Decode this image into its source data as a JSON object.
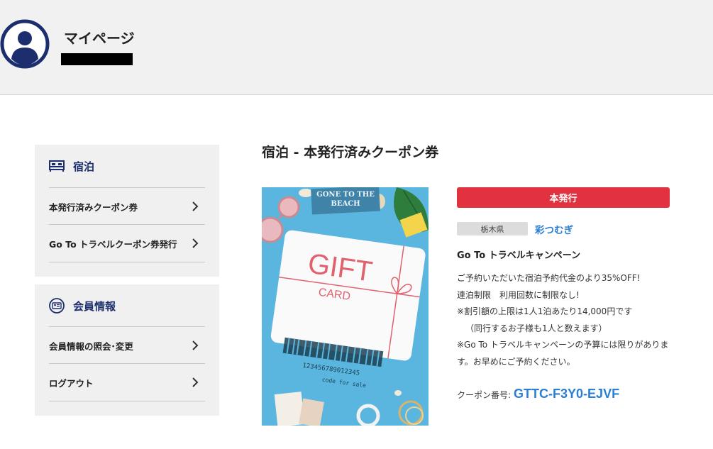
{
  "header": {
    "title": "マイページ",
    "avatar_icon": "user-avatar-icon",
    "accent": "#1c2e6e"
  },
  "sidebar": {
    "sections": [
      {
        "title": "宿泊",
        "icon": "bed-icon",
        "items": [
          {
            "label": "本発行済みクーポン券"
          },
          {
            "label": "Go To トラベルクーポン券発行"
          }
        ]
      },
      {
        "title": "会員情報",
        "icon": "member-card-icon",
        "items": [
          {
            "label": "会員情報の照会･変更"
          },
          {
            "label": "ログアウト"
          }
        ]
      }
    ]
  },
  "main": {
    "title": "宿泊 - 本発行済みクーポン券",
    "image_text": {
      "sign": "GONE TO THE",
      "sign2": "BEACH",
      "gift": "GIFT",
      "card": "CARD",
      "barcode_number": "123456789012345",
      "code_for_sale": "code for sale"
    },
    "status": {
      "label": "本発行",
      "color": "#e2323f"
    },
    "prefecture": "栃木県",
    "hotel_name": "彩つむぎ",
    "campaign": "Go To トラベルキャンペーン",
    "description": [
      "ご予約いただいた宿泊予約代金のより35%OFF!",
      "連泊制限　利用回数に制限なし!",
      "※割引額の上限は1人1泊あたり14,000円です",
      "（同行するお子様も1人と数えます）",
      "※Go To トラベルキャンペーンの予算には限りがありま",
      "す。お早めにご予約ください。"
    ],
    "coupon_label": "クーポン番号:",
    "coupon_code": "GTTC-F3Y0-EJVF",
    "link_color": "#2a7fd4"
  }
}
